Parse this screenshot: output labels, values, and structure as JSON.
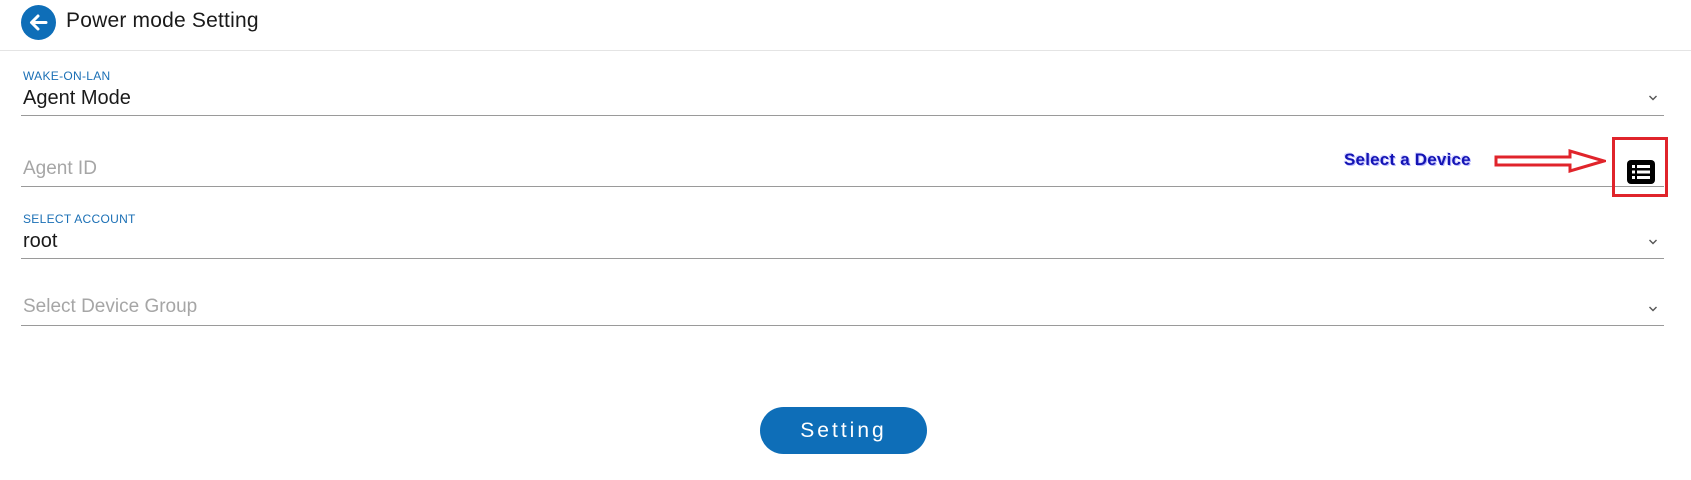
{
  "header": {
    "back_icon": "arrow-left-icon",
    "title": "Power mode Setting"
  },
  "wake_on_lan": {
    "caption": "WAKE-ON-LAN",
    "value": "Agent Mode"
  },
  "agent_id": {
    "placeholder": "Agent ID",
    "list_icon": "list-icon"
  },
  "select_account": {
    "caption": "SELECT ACCOUNT",
    "value": "root"
  },
  "device_group": {
    "placeholder": "Select Device Group"
  },
  "annotation": {
    "label": "Select a Device",
    "color": "#e0242b",
    "text_color": "#1414b4"
  },
  "actions": {
    "setting_label": "Setting"
  },
  "colors": {
    "accent": "#0e6eb8",
    "caption": "#1a6fb5"
  }
}
